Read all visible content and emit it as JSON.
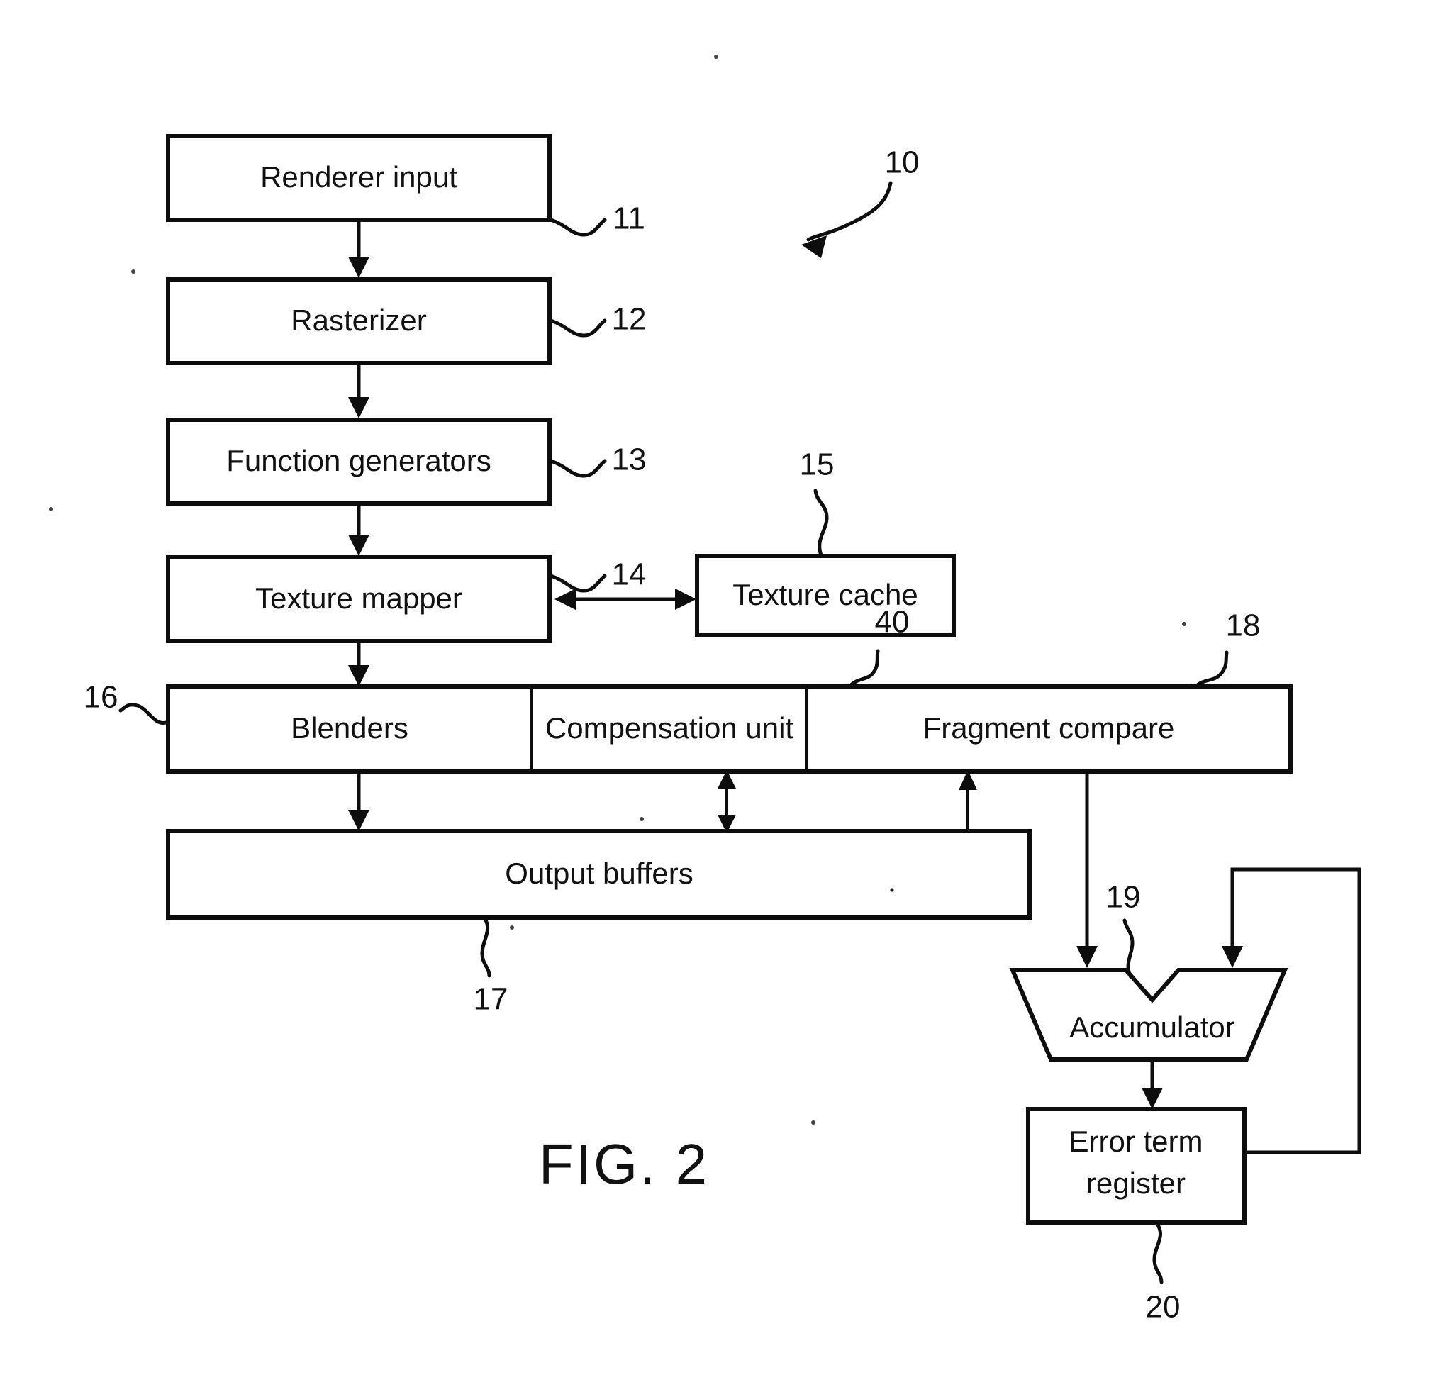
{
  "figure": {
    "caption": "FIG. 2",
    "system_ref": "10"
  },
  "blocks": [
    {
      "id": "renderer-input",
      "label": "Renderer input",
      "ref": "11"
    },
    {
      "id": "rasterizer",
      "label": "Rasterizer",
      "ref": "12"
    },
    {
      "id": "function-generators",
      "label": "Function generators",
      "ref": "13"
    },
    {
      "id": "texture-mapper",
      "label": "Texture mapper",
      "ref": "14"
    },
    {
      "id": "texture-cache",
      "label": "Texture cache",
      "ref": "15"
    },
    {
      "id": "blenders",
      "label": "Blenders",
      "ref": "16"
    },
    {
      "id": "compensation-unit",
      "label": "Compensation unit",
      "ref": "40"
    },
    {
      "id": "fragment-compare",
      "label": "Fragment compare",
      "ref": "18"
    },
    {
      "id": "output-buffers",
      "label": "Output buffers",
      "ref": "17"
    },
    {
      "id": "accumulator",
      "label": "Accumulator",
      "ref": "19"
    },
    {
      "id": "error-term-register",
      "label_line1": "Error term",
      "label_line2": "register",
      "ref": "20"
    }
  ],
  "colors": {
    "ink": "#0d0d0d",
    "paper": "#ffffff"
  }
}
